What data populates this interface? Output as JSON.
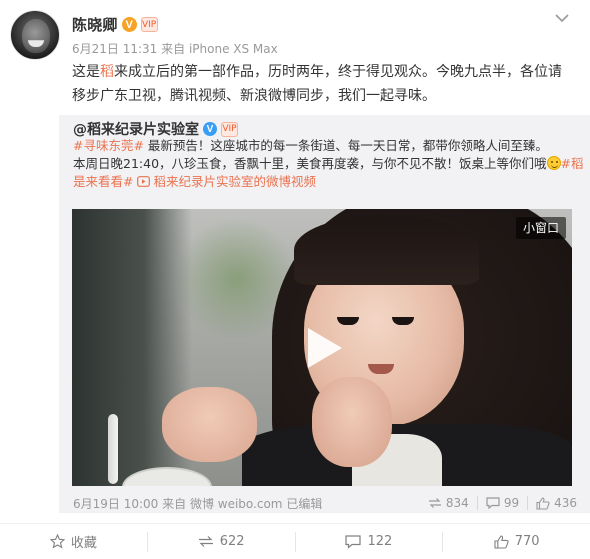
{
  "author": {
    "name": "陈晓卿",
    "verified_badge": "V",
    "vip_badge": "VIP"
  },
  "meta": {
    "date": "6月21日 11:31",
    "source": "来自 iPhone XS Max"
  },
  "post": {
    "text_before": "这是",
    "highlight": "稻",
    "text_after": "来成立后的第一部作品，历时两年，终于得见观众。今晚九点半，各位请移步广东卫视，腾讯视频、新浪微博同步，我们一起寻味。"
  },
  "repost": {
    "author": "@稻来纪录片实验室",
    "verified_badge": "V",
    "vip_badge": "VIP",
    "line1_tag": "#寻味东莞#",
    "line1_text": " 最新预告！这座城市的每一条街道、每一天日常，都带你领略人间至臻。",
    "line2_text": "本周日晚21:40，八珍玉食，香飘十里，美食再度袭，与你不见不散！饭桌上等你们哦",
    "line2_tag": "#稻是来看看#",
    "video_link": "稻来纪录片实验室的微博视频",
    "mini_window": "小窗口",
    "date": "6月19日 10:00",
    "source": "来自 微博 weibo.com",
    "edited": "已编辑",
    "stats": {
      "reposts": "834",
      "comments": "99",
      "likes": "436"
    }
  },
  "actions": {
    "favorite": "收藏",
    "repost": "622",
    "comment": "122",
    "like": "770"
  },
  "colors": {
    "accent": "#eb7350",
    "verified_orange": "#f7a325",
    "verified_blue": "#3a9ef5",
    "muted": "#999999",
    "repost_bg": "#f2f2f5"
  },
  "icons": [
    "chevron-down-icon",
    "play-icon",
    "video-link-icon",
    "repost-icon",
    "comment-icon",
    "like-icon",
    "favorite-icon",
    "smiley-icon"
  ]
}
